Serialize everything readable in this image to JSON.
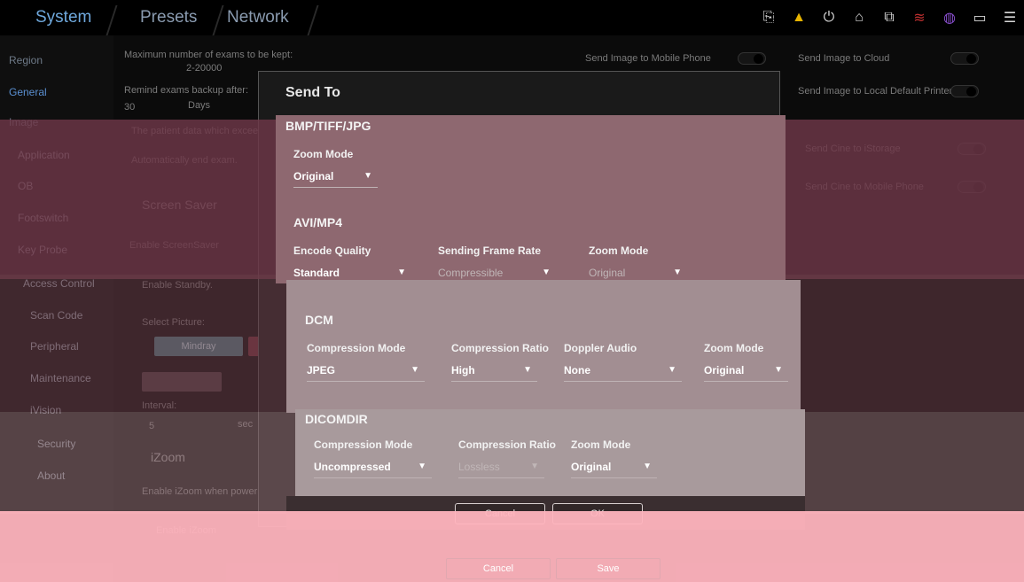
{
  "tabs": {
    "system": "System",
    "presets": "Presets",
    "network": "Network"
  },
  "status_icons": [
    "tray-icon",
    "warning-icon",
    "power-icon",
    "mouse-icon",
    "network-icon",
    "wifi-icon",
    "globe-icon",
    "battery-icon",
    "menu-icon"
  ],
  "sidebar": {
    "region": "Region",
    "general": "General",
    "image": "Image",
    "application": "Application",
    "ob": "OB",
    "footswitch": "Footswitch",
    "key_probe": "Key Probe",
    "access_control": "Access Control",
    "scan_code": "Scan Code",
    "peripheral": "Peripheral",
    "maintenance": "Maintenance",
    "ivision": "iVision",
    "security": "Security",
    "about": "About"
  },
  "page": {
    "max_exams_label": "Maximum number of exams to be kept:",
    "max_exams_range": "2-20000",
    "remind_backup_label": "Remind exams backup after:",
    "remind_backup_value": "30",
    "remind_backup_unit": "Days",
    "patient_data_note": "The patient data which exceed t",
    "auto_end_exam": "Automatically end exam.",
    "screen_saver_head": "Screen Saver",
    "enable_screensaver": "Enable ScreenSaver",
    "enable_standby": "Enable Standby.",
    "select_picture": "Select Picture:",
    "picture_option": "Mindray",
    "interval_label": "Interval:",
    "interval_value": "5",
    "interval_unit": "sec",
    "izoom_head": "iZoom",
    "enable_izoom_power": "Enable iZoom when powering on",
    "enable_izoom": "Enable iZoom",
    "send_mobile": "Send Image to Mobile Phone",
    "send_cloud": "Send Image to Cloud",
    "send_printer": "Send Image to Local Default Printer",
    "send_cine_istorage": "Send Cine to iStorage",
    "send_cine_mobile": "Send Cine to Mobile Phone",
    "cancel": "Cancel",
    "save": "Save"
  },
  "dialog": {
    "title": "Send To",
    "bmp": {
      "title": "BMP/TIFF/JPG",
      "zoom_label": "Zoom Mode",
      "zoom_value": "Original"
    },
    "avi": {
      "title": "AVI/MP4",
      "encode_label": "Encode Quality",
      "encode_value": "Standard",
      "frame_label": "Sending Frame Rate",
      "frame_value": "Compressible",
      "zoom_label": "Zoom Mode",
      "zoom_value": "Original"
    },
    "dcm": {
      "title": "DCM",
      "comp_mode_label": "Compression Mode",
      "comp_mode_value": "JPEG",
      "comp_ratio_label": "Compression Ratio",
      "comp_ratio_value": "High",
      "doppler_label": "Doppler Audio",
      "doppler_value": "None",
      "zoom_label": "Zoom Mode",
      "zoom_value": "Original"
    },
    "dicomdir": {
      "title": "DICOMDIR",
      "comp_mode_label": "Compression Mode",
      "comp_mode_value": "Uncompressed",
      "comp_ratio_label": "Compression Ratio",
      "comp_ratio_value": "Lossless",
      "zoom_label": "Zoom Mode",
      "zoom_value": "Original"
    },
    "cancel": "Cancel",
    "ok": "OK"
  },
  "colors": {
    "band_maroon": "#6e3748",
    "band_pink": "#ffb4be",
    "panel_dcm": "#a28e92"
  }
}
